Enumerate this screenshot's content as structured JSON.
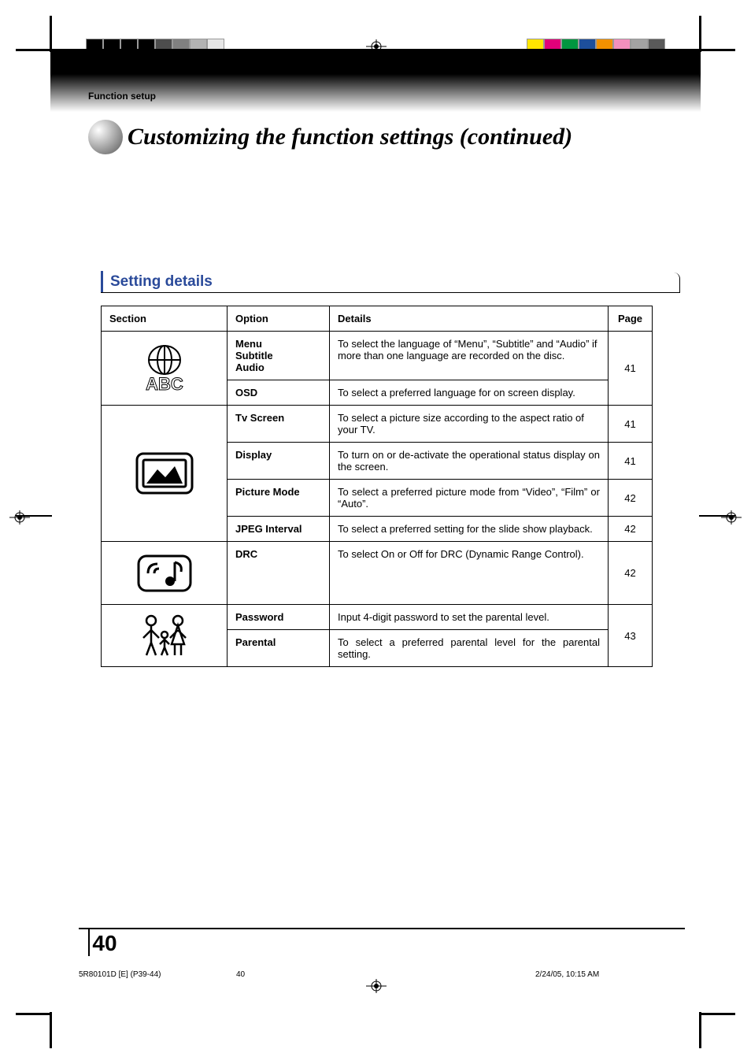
{
  "header": {
    "section_label": "Function setup"
  },
  "title": "Customizing the function settings (continued)",
  "sub_heading": "Setting details",
  "table": {
    "headers": {
      "section": "Section",
      "option": "Option",
      "details": "Details",
      "page": "Page"
    },
    "rows": {
      "r1": {
        "option_line1": "Menu",
        "option_line2": "Subtitle",
        "option_line3": "Audio",
        "details": "To select the language of “Menu”, “Subtitle” and “Audio” if more than one language are recorded on the disc.",
        "page": "41"
      },
      "r2": {
        "option": "OSD",
        "details": "To select a preferred language for on screen display."
      },
      "r3": {
        "option": "Tv Screen",
        "details": "To select a picture size according to the aspect ratio of your TV.",
        "page": "41"
      },
      "r4": {
        "option": "Display",
        "details": "To turn on or de-activate the operational status display on the screen.",
        "page": "41"
      },
      "r5": {
        "option": "Picture Mode",
        "details": "To select a preferred picture mode from “Video”, “Film” or “Auto”.",
        "page": "42"
      },
      "r6": {
        "option": "JPEG Interval",
        "details": "To select a preferred setting for the slide show playback.",
        "page": "42"
      },
      "r7": {
        "option": "DRC",
        "details": "To select On or Off for DRC (Dynamic Range Control).",
        "page": "42"
      },
      "r8": {
        "option": "Password",
        "details": "Input 4-digit password to set the parental level.",
        "page": "43"
      },
      "r9": {
        "option": "Parental",
        "details": "To select a preferred parental level for the parental setting."
      }
    }
  },
  "page_number": "40",
  "footer": {
    "left": "5R80101D [E] (P39-44)",
    "center": "40",
    "right": "2/24/05, 10:15 AM"
  },
  "colors": {
    "bar_left": [
      "#000000",
      "#000000",
      "#000000",
      "#000000",
      "#4d4d4d",
      "#808080",
      "#b3b3b3",
      "#e6e6e6"
    ],
    "bar_right": [
      "#ffe600",
      "#e2007a",
      "#009640",
      "#1d4f9c",
      "#f29100",
      "#f390bd",
      "#a3a3a3",
      "#5a5a5a"
    ]
  }
}
